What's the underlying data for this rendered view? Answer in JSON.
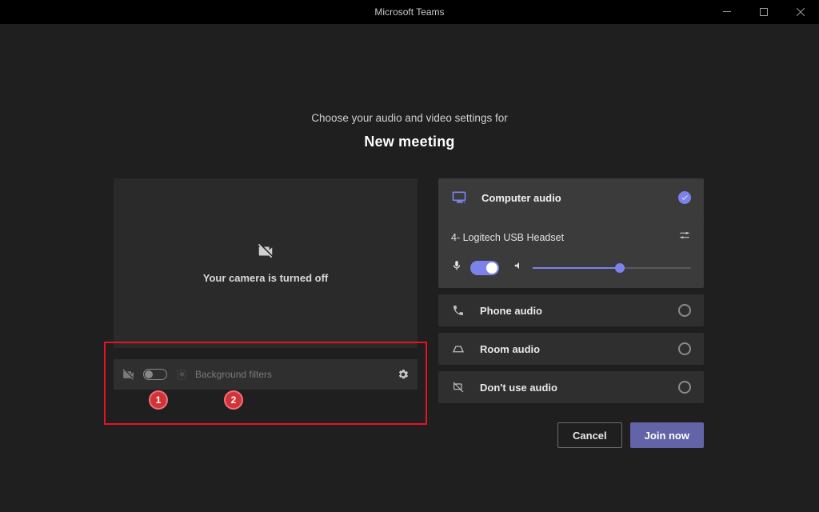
{
  "window": {
    "title": "Microsoft Teams"
  },
  "headline": {
    "subhead": "Choose your audio and video settings for",
    "title": "New meeting"
  },
  "video": {
    "off_message": "Your camera is turned off",
    "bg_filters_label": "Background filters"
  },
  "annotations": {
    "badge1": "1",
    "badge2": "2"
  },
  "audio": {
    "computer_audio_label": "Computer audio",
    "device_label": "4- Logitech USB Headset",
    "volume_percent": 55
  },
  "options": {
    "phone_label": "Phone audio",
    "room_label": "Room audio",
    "none_label": "Don't use audio"
  },
  "actions": {
    "cancel": "Cancel",
    "join": "Join now"
  }
}
